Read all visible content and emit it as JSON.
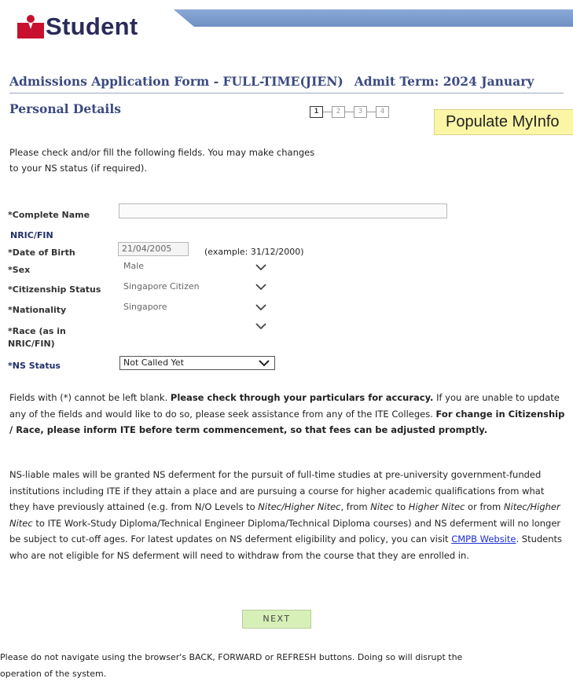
{
  "brand": {
    "logo_text": "Student",
    "accent_red": "#c8102e",
    "header_bar": "#7a99cc"
  },
  "form": {
    "title": "Admissions Application Form - FULL-TIME(JIEN)",
    "admit_term": "Admit Term: 2024 January",
    "section": "Personal Details",
    "steps": [
      "1",
      "2",
      "3",
      "4"
    ],
    "active_step": 1,
    "populate_button": "Populate MyInfo"
  },
  "intro": {
    "line1": "Please check and/or fill the following fields. You may make changes",
    "line2": "to your NS status (if required)."
  },
  "fields": {
    "complete_name_label": "*Complete Name",
    "complete_name_value": "",
    "nric_label": "NRIC/FIN",
    "dob_label": "*Date of Birth",
    "dob_value": "21/04/2005",
    "dob_example": "(example: 31/12/2000)",
    "sex_label": "*Sex",
    "sex_value": "Male",
    "citizenship_label": "*Citizenship Status",
    "citizenship_value": "Singapore Citizen",
    "nationality_label": "*Nationality",
    "nationality_value": "Singapore",
    "race_label_1": "*Race (as in",
    "race_label_2": "NRIC/FIN)",
    "race_value": "",
    "ns_label": "*NS Status",
    "ns_value": "Not Called Yet"
  },
  "notice": {
    "p1_a": "Fields with (*) cannot be left blank. ",
    "p1_b": "Please check through your particulars for accuracy.",
    "p1_c": " If you are unable to update any of the fields and would like to do so, please seek assistance from any of the ITE Colleges. ",
    "p1_d": "For change in Citizenship / Race, please inform ITE before term commencement, so that fees can be adjusted promptly.",
    "p2_a": "NS-liable males will be granted NS deferment for the pursuit of full-time studies at pre-university government-funded institutions including ITE if they attain a place and are pursuing a course for higher academic qualifications from what they have previously attained (e.g. from N/O Levels to ",
    "p2_b": "Nitec/Higher Nitec",
    "p2_c": ", from ",
    "p2_d": "Nitec",
    "p2_e": " to ",
    "p2_f": "Higher Nitec",
    "p2_g": " or from ",
    "p2_h": "Nitec/Higher Nitec",
    "p2_i": " to ITE Work-Study Diploma/Technical Engineer Diploma/Technical Diploma courses) and NS deferment will no longer be subject to cut-off ages. For latest updates on NS deferment eligibility and policy, you can visit ",
    "p2_link": "CMPB Website",
    "p2_j": ". Students who are not eligible for NS deferment will need to withdraw from the course that they are enrolled in."
  },
  "next_button": "NEXT",
  "footer": {
    "line1": "Please do not navigate using the browser's BACK, FORWARD or REFRESH buttons. Doing so will disrupt the",
    "line2": "operation of the system."
  },
  "icons": [
    "chevron-down-icon"
  ]
}
